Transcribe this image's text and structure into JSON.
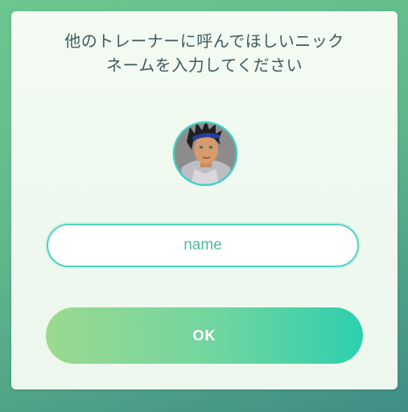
{
  "dialog": {
    "title_line1": "他のトレーナーに呼んでほしいニック",
    "title_line2": "ネームを入力してください"
  },
  "avatar": {
    "icon": "trainer-avatar-icon",
    "ring_color": "#3ed0c4"
  },
  "name_field": {
    "value": "",
    "placeholder": "name"
  },
  "ok_button": {
    "label": "OK"
  },
  "colors": {
    "accent": "#52d1c2",
    "button_start": "#9bd98f",
    "button_end": "#2dcfae",
    "title_text": "#3f5a5d"
  }
}
